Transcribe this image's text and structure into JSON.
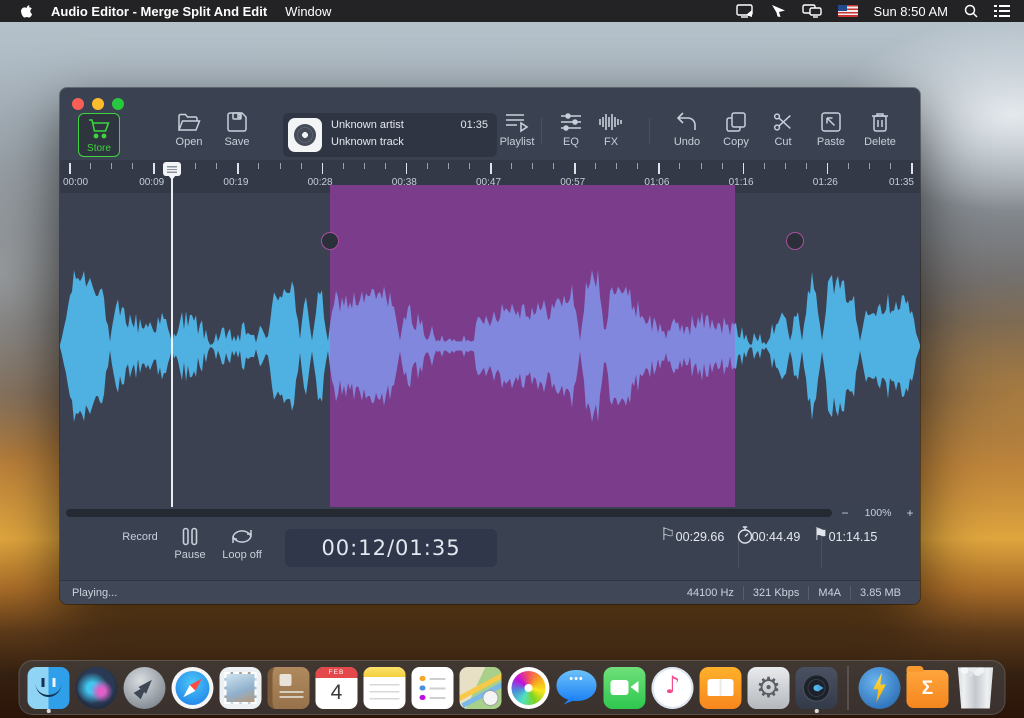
{
  "menubar": {
    "app_name": "Audio Editor - Merge Split And Edit",
    "menus": [
      "Window"
    ],
    "clock": "Sun 8:50 AM"
  },
  "toolbar": {
    "store_label": "Store",
    "open_label": "Open",
    "save_label": "Save",
    "player": {
      "artist": "Unknown artist",
      "track": "Unknown track",
      "duration": "01:35"
    },
    "playlist_label": "Playlist",
    "eq_label": "EQ",
    "fx_label": "FX",
    "undo_label": "Undo",
    "copy_label": "Copy",
    "cut_label": "Cut",
    "paste_label": "Paste",
    "delete_label": "Delete"
  },
  "ruler": {
    "labels": [
      "00:00",
      "00:09",
      "00:19",
      "00:28",
      "00:38",
      "00:47",
      "00:57",
      "01:06",
      "01:16",
      "01:26",
      "01:35"
    ]
  },
  "zoom_control": {
    "minus": "−",
    "level": "100%",
    "plus": "+"
  },
  "transport": {
    "record_label": "Record",
    "pause_label": "Pause",
    "loop_label": "Loop off",
    "time_display": "00:12/01:35",
    "marker_start": {
      "icon": "⚐",
      "value": "00:29.66"
    },
    "timer": {
      "value": "00:44.49"
    },
    "marker_end": {
      "icon": "⚑",
      "value": "01:14.15"
    }
  },
  "statusbar": {
    "state": "Playing...",
    "info": [
      "44100 Hz",
      "321 Kbps",
      "M4A",
      "3.85 MB"
    ]
  },
  "dock": {
    "items": [
      {
        "id": "finder",
        "running": true
      },
      {
        "id": "siri"
      },
      {
        "id": "launchpad"
      },
      {
        "id": "safari"
      },
      {
        "id": "mail"
      },
      {
        "id": "contacts"
      },
      {
        "id": "calendar",
        "glyph": "4",
        "glyph2": "FEB"
      },
      {
        "id": "notes"
      },
      {
        "id": "reminders"
      },
      {
        "id": "maps"
      },
      {
        "id": "photos"
      },
      {
        "id": "messages",
        "glyph": "•••"
      },
      {
        "id": "facetime"
      },
      {
        "id": "itunes",
        "glyph": "♪"
      },
      {
        "id": "ibooks"
      },
      {
        "id": "sysprefs",
        "glyph": "⚙"
      },
      {
        "id": "audio-editor",
        "running": true
      },
      {
        "id": "separator"
      },
      {
        "id": "lightning-app"
      },
      {
        "id": "sigma-folder",
        "glyph": "Σ"
      },
      {
        "id": "trash"
      }
    ]
  },
  "colors": {
    "wave": "#4fb0e2",
    "wave_selected": "#8187dd",
    "selection": "#7b3d8b",
    "wave_bg": "#3b4151",
    "accent_green": "#3fd43f",
    "record_red": "#ee5a60"
  }
}
